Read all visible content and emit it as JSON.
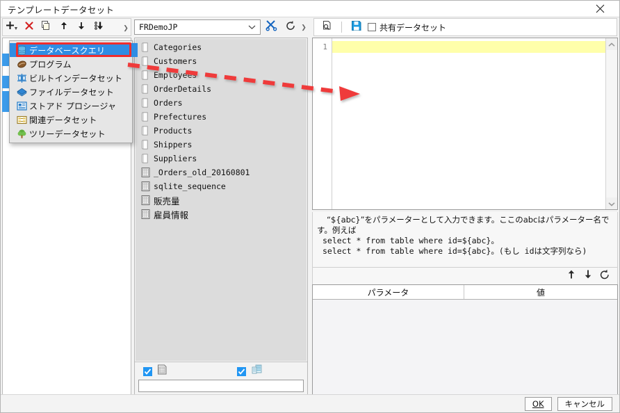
{
  "window": {
    "title": "テンプレートデータセット",
    "close_icon": "close-icon"
  },
  "toolbar": {
    "add_icon": "plus-icon",
    "add_caret_icon": "caret-down-icon",
    "delete_icon": "x-delete-icon",
    "copy_icon": "copy-icon",
    "move_up_icon": "arrow-up-icon",
    "move_down_icon": "arrow-down-icon",
    "move_bottom_icon": "move-to-bottom-icon",
    "overflow_icon": "chevron-right-icon",
    "connection_value": "FRDemoJP",
    "connection_dropdown_icon": "chevron-down-icon",
    "tools_icon": "wrench-scissors-icon",
    "refresh_icon": "refresh-icon",
    "overflow2_icon": "chevron-right-icon",
    "preview_icon": "magnifier-page-icon",
    "save_icon": "save-blue-icon",
    "shared_dataset_label": "共有データセット",
    "shared_dataset_checked": false
  },
  "menu": {
    "items": [
      {
        "label": "データベースクエリ",
        "icon": "database-icon",
        "selected": true
      },
      {
        "label": "プログラム",
        "icon": "coffee-bean-icon",
        "selected": false
      },
      {
        "label": "ビルトインデータセット",
        "icon": "builtin-table-icon",
        "selected": false
      },
      {
        "label": "ファイルデータセット",
        "icon": "blue-file-icon",
        "selected": false
      },
      {
        "label": "ストアド プロシージャ",
        "icon": "stored-procedure-icon",
        "selected": false
      },
      {
        "label": "関連データセット",
        "icon": "relation-icon",
        "selected": false
      },
      {
        "label": "ツリーデータセット",
        "icon": "tree-icon",
        "selected": false
      }
    ]
  },
  "tables": {
    "items": [
      {
        "name": "Categories",
        "icon": "table-icon",
        "cjk": false
      },
      {
        "name": "Customers",
        "icon": "table-icon",
        "cjk": false
      },
      {
        "name": "Employees",
        "icon": "table-icon",
        "cjk": false
      },
      {
        "name": "OrderDetails",
        "icon": "table-icon",
        "cjk": false
      },
      {
        "name": "Orders",
        "icon": "table-icon",
        "cjk": false
      },
      {
        "name": "Prefectures",
        "icon": "table-icon",
        "cjk": false
      },
      {
        "name": "Products",
        "icon": "table-icon",
        "cjk": false
      },
      {
        "name": "Shippers",
        "icon": "table-icon",
        "cjk": false
      },
      {
        "name": "Suppliers",
        "icon": "table-icon",
        "cjk": false
      },
      {
        "name": "_Orders_old_20160801",
        "icon": "view-icon",
        "cjk": false
      },
      {
        "name": "sqlite_sequence",
        "icon": "view-icon",
        "cjk": false
      },
      {
        "name": "販売量",
        "icon": "view-icon",
        "cjk": true
      },
      {
        "name": "雇員情報",
        "icon": "view-icon",
        "cjk": true
      }
    ],
    "footer": {
      "show_tables_checked": true,
      "show_tables_icon": "table-grid-icon",
      "show_views_checked": true,
      "show_views_icon": "views-icon",
      "filter_value": ""
    }
  },
  "editor": {
    "line_numbers": [
      "1"
    ],
    "content": "",
    "scroll_up_icon": "chevron-up-icon",
    "scroll_down_icon": "chevron-down-icon"
  },
  "help": {
    "line1": "“${abc}”をパラメーターとして入力できます。ここのabcはパラメーター名で",
    "line2": "す。例えば",
    "line3": "select * from table where id=${abc}。",
    "line4": "select * from table where id=${abc}。(もし idは文字列なら)"
  },
  "params": {
    "move_up_icon": "arrow-up-icon",
    "move_down_icon": "arrow-down-icon",
    "refresh_icon": "refresh-icon",
    "col_param": "パラメータ",
    "col_value": "値",
    "rows": []
  },
  "footer": {
    "ok_label": "OK",
    "ok_mnemonic": "O",
    "cancel_label": "キャンセル"
  },
  "annotation": {
    "highlight_color": "#ef2d2d",
    "arrow_style": "dashed"
  }
}
